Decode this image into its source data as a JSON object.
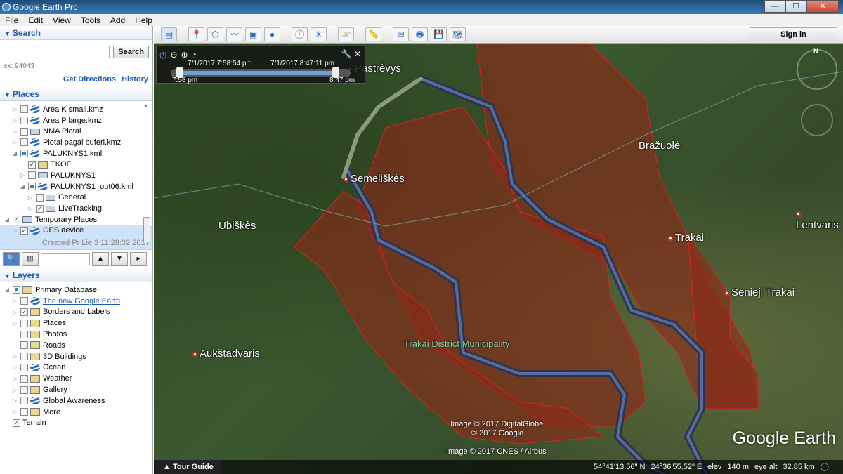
{
  "window": {
    "title": "Google Earth Pro",
    "min": "—",
    "max": "☐",
    "close": "✕"
  },
  "menu": [
    "File",
    "Edit",
    "View",
    "Tools",
    "Add",
    "Help"
  ],
  "search": {
    "header": "Search",
    "placeholder": "",
    "button": "Search",
    "example": "ex: 94043",
    "get_directions": "Get Directions",
    "history": "History"
  },
  "places": {
    "header": "Places",
    "items": [
      {
        "label": "Area K small.kmz",
        "indent": 0,
        "checked": false,
        "icon": "globe",
        "exp": "▷"
      },
      {
        "label": "Area P large.kmz",
        "indent": 0,
        "checked": false,
        "icon": "globe",
        "exp": "▷"
      },
      {
        "label": "NMA Plotai",
        "indent": 0,
        "checked": false,
        "icon": "folder",
        "exp": "▷"
      },
      {
        "label": "Plotai pagal buferi.kmz",
        "indent": 0,
        "checked": false,
        "icon": "globe",
        "exp": "▷"
      },
      {
        "label": "PALUKNYS1.kml",
        "indent": 0,
        "checked": "partial",
        "icon": "globe",
        "exp": "◢"
      },
      {
        "label": "TKOF",
        "indent": 1,
        "checked": true,
        "icon": "path",
        "exp": ""
      },
      {
        "label": "PALUKNYS1",
        "indent": 1,
        "checked": false,
        "icon": "folder",
        "exp": "▷"
      },
      {
        "label": "PALUKNYS1_out06.kml",
        "indent": 1,
        "checked": "partial",
        "icon": "globe",
        "exp": "◢"
      },
      {
        "label": "General",
        "indent": 2,
        "checked": false,
        "icon": "folder",
        "exp": "▷"
      },
      {
        "label": "LiveTracking",
        "indent": 2,
        "checked": true,
        "icon": "folder",
        "exp": "▷"
      },
      {
        "label": "Temporary Places",
        "indent": -1,
        "checked": true,
        "icon": "folder",
        "exp": "◢"
      },
      {
        "label": "GPS device",
        "indent": 0,
        "checked": true,
        "icon": "globe",
        "exp": "▷",
        "selected": true
      }
    ],
    "selected_sub": "Created Pr Lie 3 11:28:02 2017"
  },
  "layers": {
    "header": "Layers",
    "items": [
      {
        "label": "Primary Database",
        "indent": -1,
        "checked": "partial",
        "exp": "◢",
        "icon": "db"
      },
      {
        "label": "The new Google Earth",
        "indent": 0,
        "checked": false,
        "exp": "▷",
        "icon": "globe",
        "link": true
      },
      {
        "label": "Borders and Labels",
        "indent": 0,
        "checked": true,
        "exp": "▷",
        "icon": "flag"
      },
      {
        "label": "Places",
        "indent": 0,
        "checked": false,
        "exp": "▷",
        "icon": "pin"
      },
      {
        "label": "Photos",
        "indent": 0,
        "checked": false,
        "exp": "",
        "icon": "photo"
      },
      {
        "label": "Roads",
        "indent": 0,
        "checked": false,
        "exp": "",
        "icon": "road"
      },
      {
        "label": "3D Buildings",
        "indent": 0,
        "checked": false,
        "exp": "▷",
        "icon": "building"
      },
      {
        "label": "Ocean",
        "indent": 0,
        "checked": false,
        "exp": "▷",
        "icon": "globe"
      },
      {
        "label": "Weather",
        "indent": 0,
        "checked": false,
        "exp": "▷",
        "icon": "sun"
      },
      {
        "label": "Gallery",
        "indent": 0,
        "checked": false,
        "exp": "▷",
        "icon": "star"
      },
      {
        "label": "Global Awareness",
        "indent": 0,
        "checked": false,
        "exp": "▷",
        "icon": "globe"
      },
      {
        "label": "More",
        "indent": 0,
        "checked": false,
        "exp": "▷",
        "icon": "more"
      },
      {
        "label": "Terrain",
        "indent": -1,
        "checked": true,
        "exp": "",
        "icon": ""
      }
    ]
  },
  "toolbar": {
    "sign_in": "Sign in"
  },
  "time_slider": {
    "start_full": "7/1/2017   7:58:54 pm",
    "end_full": "7/1/2017   8:47:11 pm",
    "start_short": "7:58 pm",
    "end_short": "8:47 pm"
  },
  "map": {
    "places": [
      "Pastrėvys",
      "Semeliškės",
      "Ubiškės",
      "Bražuolė",
      "Trakai",
      "Lentvaris",
      "Senieji Trakai",
      "Aukštadvaris"
    ],
    "district": "Trakai District Municipality",
    "credits": [
      "Image © 2017 DigitalGlobe",
      "© 2017 Google",
      "Image © 2017 CNES / Airbus"
    ],
    "logo": "Google Earth",
    "compass_n": "N"
  },
  "status": {
    "tour_guide": "Tour Guide",
    "lat": "54°41'13.56\" N",
    "lon": "24°36'55.52\" E",
    "elev_label": "elev",
    "elev": "140 m",
    "eye_label": "eye alt",
    "eye": "32.85 km"
  },
  "colors": {
    "polygon": "#8a2a1c",
    "track": "#3c4e78",
    "accent": "#1e5aa8"
  }
}
